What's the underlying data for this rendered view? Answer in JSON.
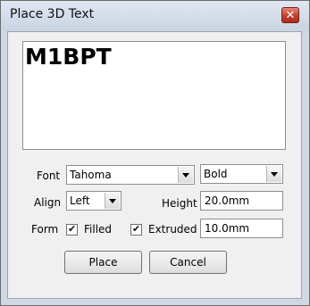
{
  "window": {
    "title": "Place 3D Text",
    "close_glyph": "✕"
  },
  "preview": {
    "text": "M1BPT"
  },
  "font": {
    "label": "Font",
    "family": "Tahoma",
    "style": "Bold"
  },
  "align": {
    "label": "Align",
    "value": "Left"
  },
  "height": {
    "label": "Height",
    "value": "20.0mm"
  },
  "form": {
    "label": "Form",
    "filled_label": "Filled",
    "filled_checked": true,
    "extruded_label": "Extruded",
    "extruded_checked": true,
    "extrude_value": "10.0mm"
  },
  "buttons": {
    "place": "Place",
    "cancel": "Cancel"
  }
}
